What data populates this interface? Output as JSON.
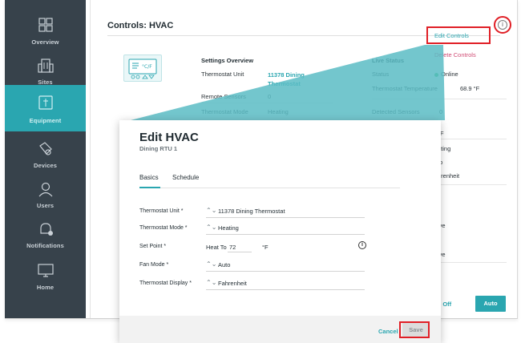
{
  "sidebar": {
    "items": [
      {
        "label": "Overview",
        "icon": "overview-icon",
        "active": false
      },
      {
        "label": "Sites",
        "icon": "sites-icon",
        "active": false
      },
      {
        "label": "Equipment",
        "icon": "equipment-icon",
        "active": true
      },
      {
        "label": "Devices",
        "icon": "devices-icon",
        "active": false
      },
      {
        "label": "Users",
        "icon": "users-icon",
        "active": false
      },
      {
        "label": "Notifications",
        "icon": "notifications-icon",
        "active": false
      },
      {
        "label": "Home",
        "icon": "home-icon",
        "active": false
      }
    ]
  },
  "page": {
    "title": "Controls: HVAC",
    "info_icon": "i",
    "edit_controls": "Edit Controls",
    "delete_controls": "Delete Controls"
  },
  "settings_overview": {
    "heading": "Settings Overview",
    "rows": [
      {
        "label": "Thermostat Unit",
        "value": "11378 Dining Thermostat"
      },
      {
        "label": "Remote Sensors",
        "value": "0"
      },
      {
        "label": "Thermostat Mode",
        "value": "Heating"
      }
    ]
  },
  "live_status": {
    "heading": "Live Status",
    "rows": [
      {
        "label": "Status",
        "value": "Online"
      },
      {
        "label": "Thermostat Temperature",
        "value": "68.9 °F"
      },
      {
        "label": "Detected Sensors",
        "value": "0"
      }
    ]
  },
  "peek_values": [
    "°F",
    "ating",
    "to",
    "hrenheit",
    "e",
    "e",
    "ive",
    "e",
    "ive"
  ],
  "bottom_controls": {
    "force_off": "rce Off",
    "auto": "Auto"
  },
  "modal": {
    "title": "Edit HVAC",
    "subtitle": "Dining RTU 1",
    "tabs": [
      "Basics",
      "Schedule"
    ],
    "active_tab": "Basics",
    "fields": {
      "thermostat_unit": {
        "label": "Thermostat Unit *",
        "value": "11378 Dining Thermostat"
      },
      "thermostat_mode": {
        "label": "Thermostat Mode *",
        "value": "Heating"
      },
      "set_point": {
        "label": "Set Point *",
        "prefix": "Heat To",
        "value": "72",
        "unit": "°F",
        "info": "i"
      },
      "fan_mode": {
        "label": "Fan Mode *",
        "value": "Auto"
      },
      "thermostat_display": {
        "label": "Thermostat Display *",
        "value": "Fahrenheit"
      }
    },
    "cancel": "Cancel",
    "save": "Save"
  },
  "colors": {
    "sidebar_bg": "#37424b",
    "accent": "#2aa6b0",
    "highlight": "#e01f26",
    "delete": "#d04b74",
    "online": "#3bbf6b"
  }
}
